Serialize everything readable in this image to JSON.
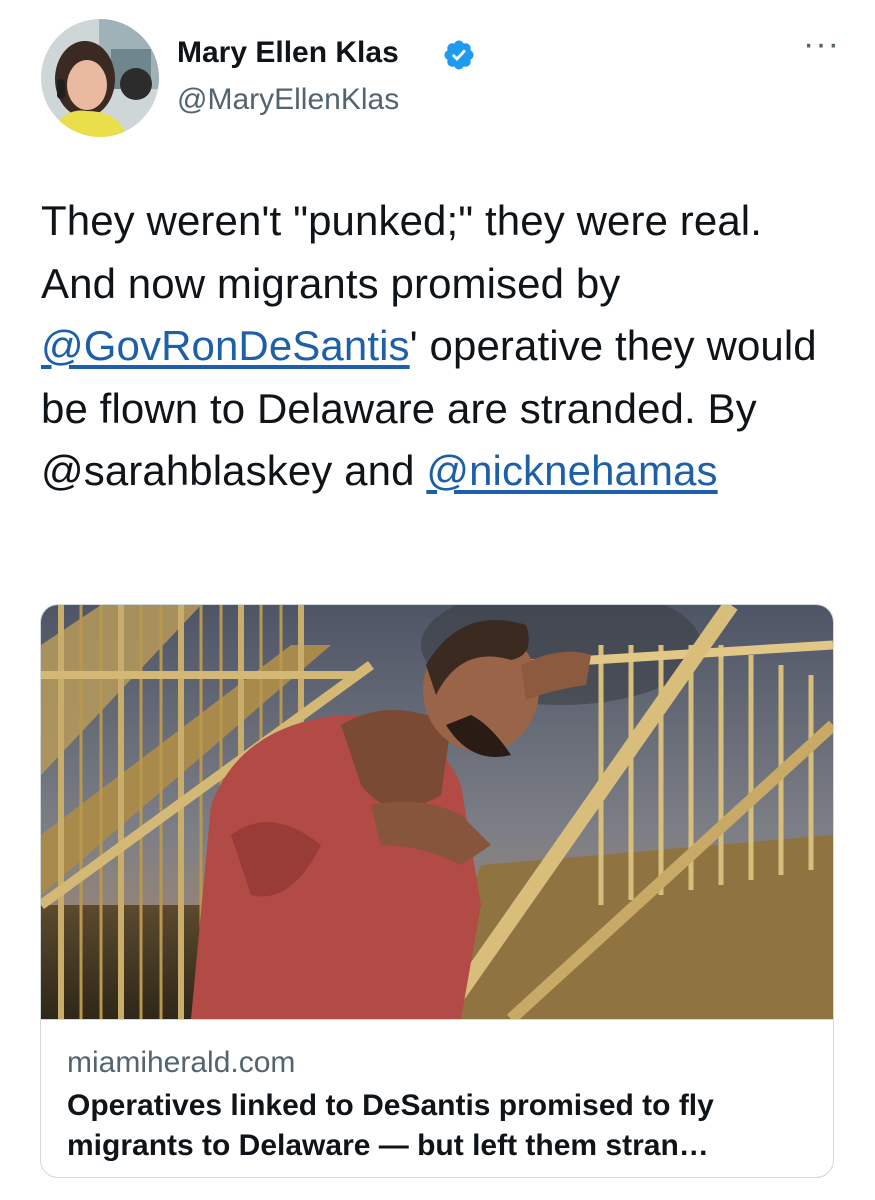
{
  "author": {
    "display_name": "Mary Ellen Klas",
    "handle": "@MaryEllenKlas",
    "verified": true,
    "avatar_icon": "profile-photo-icon"
  },
  "menu": {
    "more_label": "···"
  },
  "tweet": {
    "text_1": "They weren't \"punked;\" they were real. And now migrants promised by ",
    "mention_1": "@GovRonDeSantis",
    "text_2": "' operative they would be flown to Delaware are stranded. By @sarahblaskey and ",
    "mention_2": "@nicknehamas"
  },
  "link_card": {
    "domain": "miamiherald.com",
    "title_line_1": "Operatives linked to DeSantis promised to fly",
    "title_line_2": "migrants to Delaware — but left them stran…"
  },
  "colors": {
    "text": "#0f1419",
    "secondary": "#536471",
    "link": "#1d5fa8",
    "verified_badge": "#1d9bf0",
    "border": "#cfd9de"
  }
}
